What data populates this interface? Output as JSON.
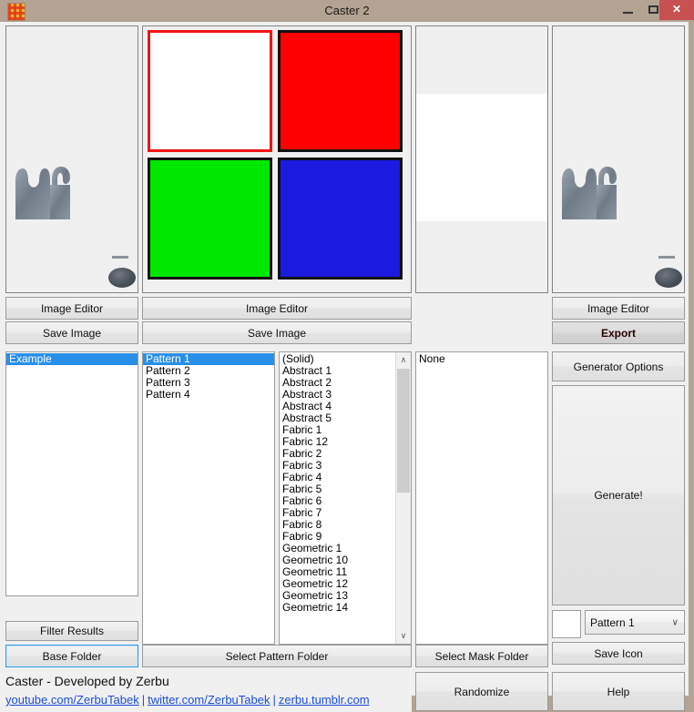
{
  "window": {
    "title": "Caster 2",
    "icon": "checkered-pattern-icon",
    "minimize_label": "–",
    "maximize_label": "□",
    "close_label": "✕",
    "frame_color": "#b2a392",
    "close_color": "#c75050"
  },
  "previews": {
    "left": {
      "name": "texture-preview-left"
    },
    "swatches": {
      "items": [
        {
          "name": "swatch-white",
          "color": "#ffffff",
          "selected": true
        },
        {
          "name": "swatch-red",
          "color": "#fe0000",
          "selected": false
        },
        {
          "name": "swatch-green",
          "color": "#00e800",
          "selected": false
        },
        {
          "name": "swatch-blue",
          "color": "#1a1ae0",
          "selected": false
        }
      ],
      "selection_color": "#f01414",
      "border_color": "#121212"
    },
    "mask": {
      "name": "mask-preview",
      "band_color": "#ffffff"
    },
    "right": {
      "name": "texture-preview-right"
    }
  },
  "buttons": {
    "image_editor_left": "Image Editor",
    "save_image_left": "Save Image",
    "image_editor_center": "Image Editor",
    "save_image_center": "Save Image",
    "image_editor_right": "Image Editor",
    "export": "Export",
    "generator_options": "Generator Options",
    "generate": "Generate!",
    "save_icon": "Save Icon",
    "filter_results": "Filter Results",
    "base_folder": "Base Folder",
    "select_pattern_folder": "Select Pattern Folder",
    "select_mask_folder": "Select Mask Folder",
    "randomize": "Randomize",
    "help": "Help"
  },
  "lists": {
    "results": {
      "name": "results-list",
      "items": [
        {
          "label": "Example",
          "selected": true
        }
      ]
    },
    "patterns": {
      "name": "pattern-list",
      "items": [
        {
          "label": "Pattern 1",
          "selected": true
        },
        {
          "label": "Pattern 2",
          "selected": false
        },
        {
          "label": "Pattern 3",
          "selected": false
        },
        {
          "label": "Pattern 4",
          "selected": false
        }
      ]
    },
    "library": {
      "name": "pattern-library-list",
      "items": [
        {
          "label": "(Solid)",
          "selected": false
        },
        {
          "label": "Abstract 1",
          "selected": false
        },
        {
          "label": "Abstract 2",
          "selected": false
        },
        {
          "label": "Abstract 3",
          "selected": false
        },
        {
          "label": "Abstract 4",
          "selected": false
        },
        {
          "label": "Abstract 5",
          "selected": false
        },
        {
          "label": "Fabric 1",
          "selected": false
        },
        {
          "label": "Fabric 12",
          "selected": false
        },
        {
          "label": "Fabric 2",
          "selected": false
        },
        {
          "label": "Fabric 3",
          "selected": false
        },
        {
          "label": "Fabric 4",
          "selected": false
        },
        {
          "label": "Fabric 5",
          "selected": false
        },
        {
          "label": "Fabric 6",
          "selected": false
        },
        {
          "label": "Fabric 7",
          "selected": false
        },
        {
          "label": "Fabric 8",
          "selected": false
        },
        {
          "label": "Fabric 9",
          "selected": false
        },
        {
          "label": "Geometric 1",
          "selected": false
        },
        {
          "label": "Geometric 10",
          "selected": false
        },
        {
          "label": "Geometric 11",
          "selected": false
        },
        {
          "label": "Geometric 12",
          "selected": false
        },
        {
          "label": "Geometric 13",
          "selected": false
        },
        {
          "label": "Geometric 14",
          "selected": false
        }
      ],
      "scrollbar": {
        "up_arrow": "∧",
        "down_arrow": "∨"
      }
    },
    "masks": {
      "name": "mask-list",
      "items": [
        {
          "label": "None",
          "selected": false
        }
      ]
    }
  },
  "pattern_selector": {
    "color_swatch": "#ffffff",
    "selected": "Pattern 1",
    "chevron": "∨"
  },
  "credits": {
    "line1": "Caster - Developed by Zerbu",
    "links": [
      "youtube.com/ZerbuTabek",
      "twitter.com/ZerbuTabek",
      "zerbu.tumblr.com"
    ],
    "separator": "|"
  }
}
